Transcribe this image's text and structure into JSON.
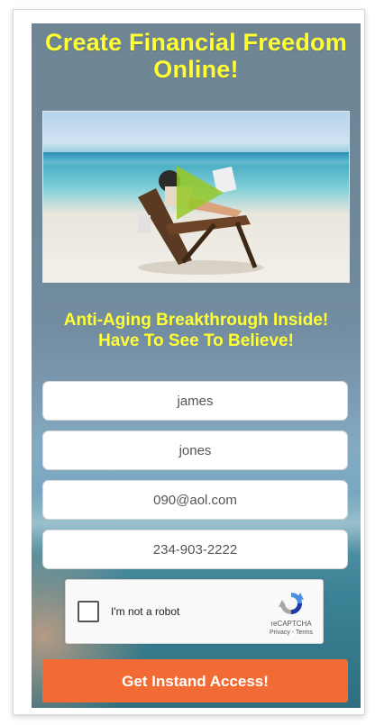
{
  "page": {
    "headline": "Create Financial Freedom Online!",
    "subheadline_line1": "Anti-Aging Breakthrough Inside!",
    "subheadline_line2": "Have To See To Believe!"
  },
  "video": {
    "play_icon": "play-icon",
    "scene": "beach-chair"
  },
  "form": {
    "first_name": "james",
    "last_name": "jones",
    "email": "090@aol.com",
    "phone": "234-903-2222"
  },
  "captcha": {
    "label": "I'm not a robot",
    "brand": "reCAPTCHA",
    "links": "Privacy - Terms",
    "icon": "recaptcha-icon"
  },
  "cta": {
    "label": "Get Instand Access!"
  },
  "colors": {
    "headline": "#ffff33",
    "cta": "#f36b34",
    "panel": "#6f8594"
  }
}
